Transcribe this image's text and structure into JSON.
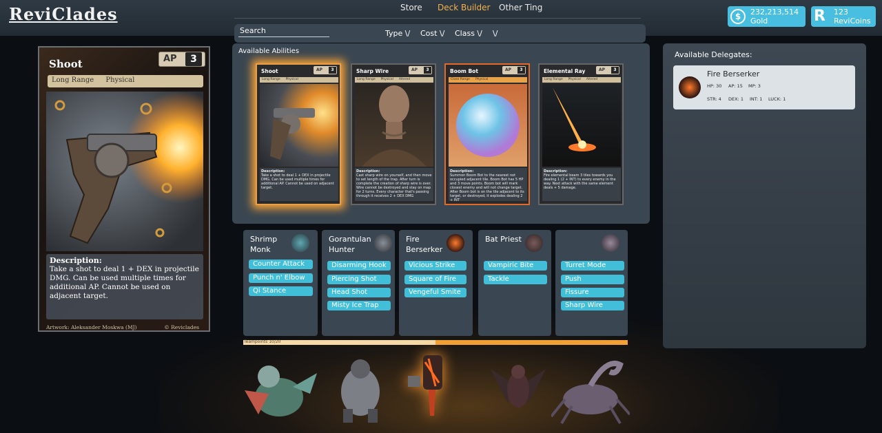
{
  "app": {
    "logo": "ReviClades"
  },
  "nav": {
    "items": [
      {
        "label": "Store",
        "active": false
      },
      {
        "label": "Deck Builder",
        "active": true
      },
      {
        "label": "Other Ting",
        "active": false
      }
    ]
  },
  "currency": {
    "gold": {
      "amount": "232,213,514",
      "label": "Gold",
      "icon": "coin-icon"
    },
    "revicoins": {
      "amount": "123",
      "label": "ReviCoins",
      "icon": "revicoin-icon"
    }
  },
  "search": {
    "label": "Search"
  },
  "filters": [
    "Type \\/",
    "Cost \\/",
    "Class \\/",
    "\\/"
  ],
  "selected_card": {
    "title": "Shoot",
    "ap_label": "AP",
    "ap": "3",
    "tags": [
      "Long Range",
      "Physical"
    ],
    "description_heading": "Description:",
    "description": "Take a shot to deal 1 + DEX in projectile DMG. Can be used multiple times for additional AP. Cannot be used on adjacent target.",
    "artist": "Artwork: Aleksander Moskwa (MJ)",
    "copyright": "© Reviclades"
  },
  "abilities_panel": {
    "title": "Available Abilities",
    "cards": [
      {
        "title": "Shoot",
        "ap_label": "AP",
        "ap": "3",
        "tags": [
          "Long Range",
          "Physical"
        ],
        "desc_heading": "Description:",
        "desc": "Take a shot to deal 1 + DEX in projectile DMG. Can be used multiple times for additional AP. Cannot be used on adjacent target.",
        "selected": true
      },
      {
        "title": "Sharp Wire",
        "ap_label": "AP",
        "ap": "3",
        "tags": [
          "Long Range",
          "Physical",
          "Altered"
        ],
        "desc_heading": "Description:",
        "desc": "Cast sharp wire on yourself, and then move to set length of the trap. After turn is complete the creation of sharp wire is over. Wire cannot be destroyed and stay on map for 2 turns. Every character that's passing through it receives 2 + DEX DMG",
        "selected": false
      },
      {
        "title": "Boom Bot",
        "ap_label": "AP",
        "ap": "3",
        "tags": [
          "Close Range",
          "Physical"
        ],
        "desc_heading": "Description:",
        "desc": "Summon Boom Bot to the nearest not occupied adjacent tile. Boom Bot has 5 HP and 3 move points. Boom bot will mark closest enemy and will not change target. After Boom bot is on the tile adjacent to its target, or destroyed, it explodes dealing 2 + INT",
        "selected": false
      },
      {
        "title": "Elemental Ray",
        "ap_label": "AP",
        "ap": "3",
        "tags": [
          "Long Range",
          "Physical",
          "Altered"
        ],
        "desc_heading": "Description:",
        "desc": "Fire elemental beam 3 tiles towards you dealing 1 (2 + INT) to every enemy in the way. Next attack with the same element deals + 5 damage.",
        "selected": false
      }
    ]
  },
  "team": [
    {
      "name": "Shrimp Monk",
      "portrait": "shrimp-monk-portrait",
      "abilities": [
        "Counter Attack",
        "Punch n' Elbow",
        "Qi Stance"
      ]
    },
    {
      "name": "Gorantulan Hunter",
      "portrait": "gorantulan-hunter-portrait",
      "abilities": [
        "Disarming Hook",
        "Piercing Shot",
        "Head Shot",
        "Misty Ice Trap"
      ]
    },
    {
      "name": "Fire Berserker",
      "portrait": "fire-berserker-portrait",
      "abilities": [
        "Vicious Strike",
        "Square of Fire",
        "Vengeful Smite"
      ]
    },
    {
      "name": "Bat Priest",
      "portrait": "bat-priest-portrait",
      "abilities": [
        "Vampiric Bite",
        "Tackle"
      ]
    },
    {
      "name": "",
      "portrait": "scorpion-portrait",
      "abilities": [
        "Turret Mode",
        "Push",
        "Fissure",
        "Sharp Wire"
      ]
    }
  ],
  "teampoints": {
    "label": "Teampoints 10/20",
    "current": 10,
    "max": 20
  },
  "delegates_panel": {
    "title": "Available Delegates:",
    "delegates": [
      {
        "name": "Fire Berserker",
        "hp": "HP: 30",
        "ap": "AP: 15",
        "mp": "MP: 3",
        "str": "STR: 4",
        "dex": "DEX: 1",
        "int": "INT: 1",
        "luck": "LUCK: 1"
      }
    ]
  },
  "colors": {
    "accent": "#42bfd8",
    "highlight": "#f2b24e",
    "panel": "#3a4651",
    "progress": "#f0a035"
  }
}
